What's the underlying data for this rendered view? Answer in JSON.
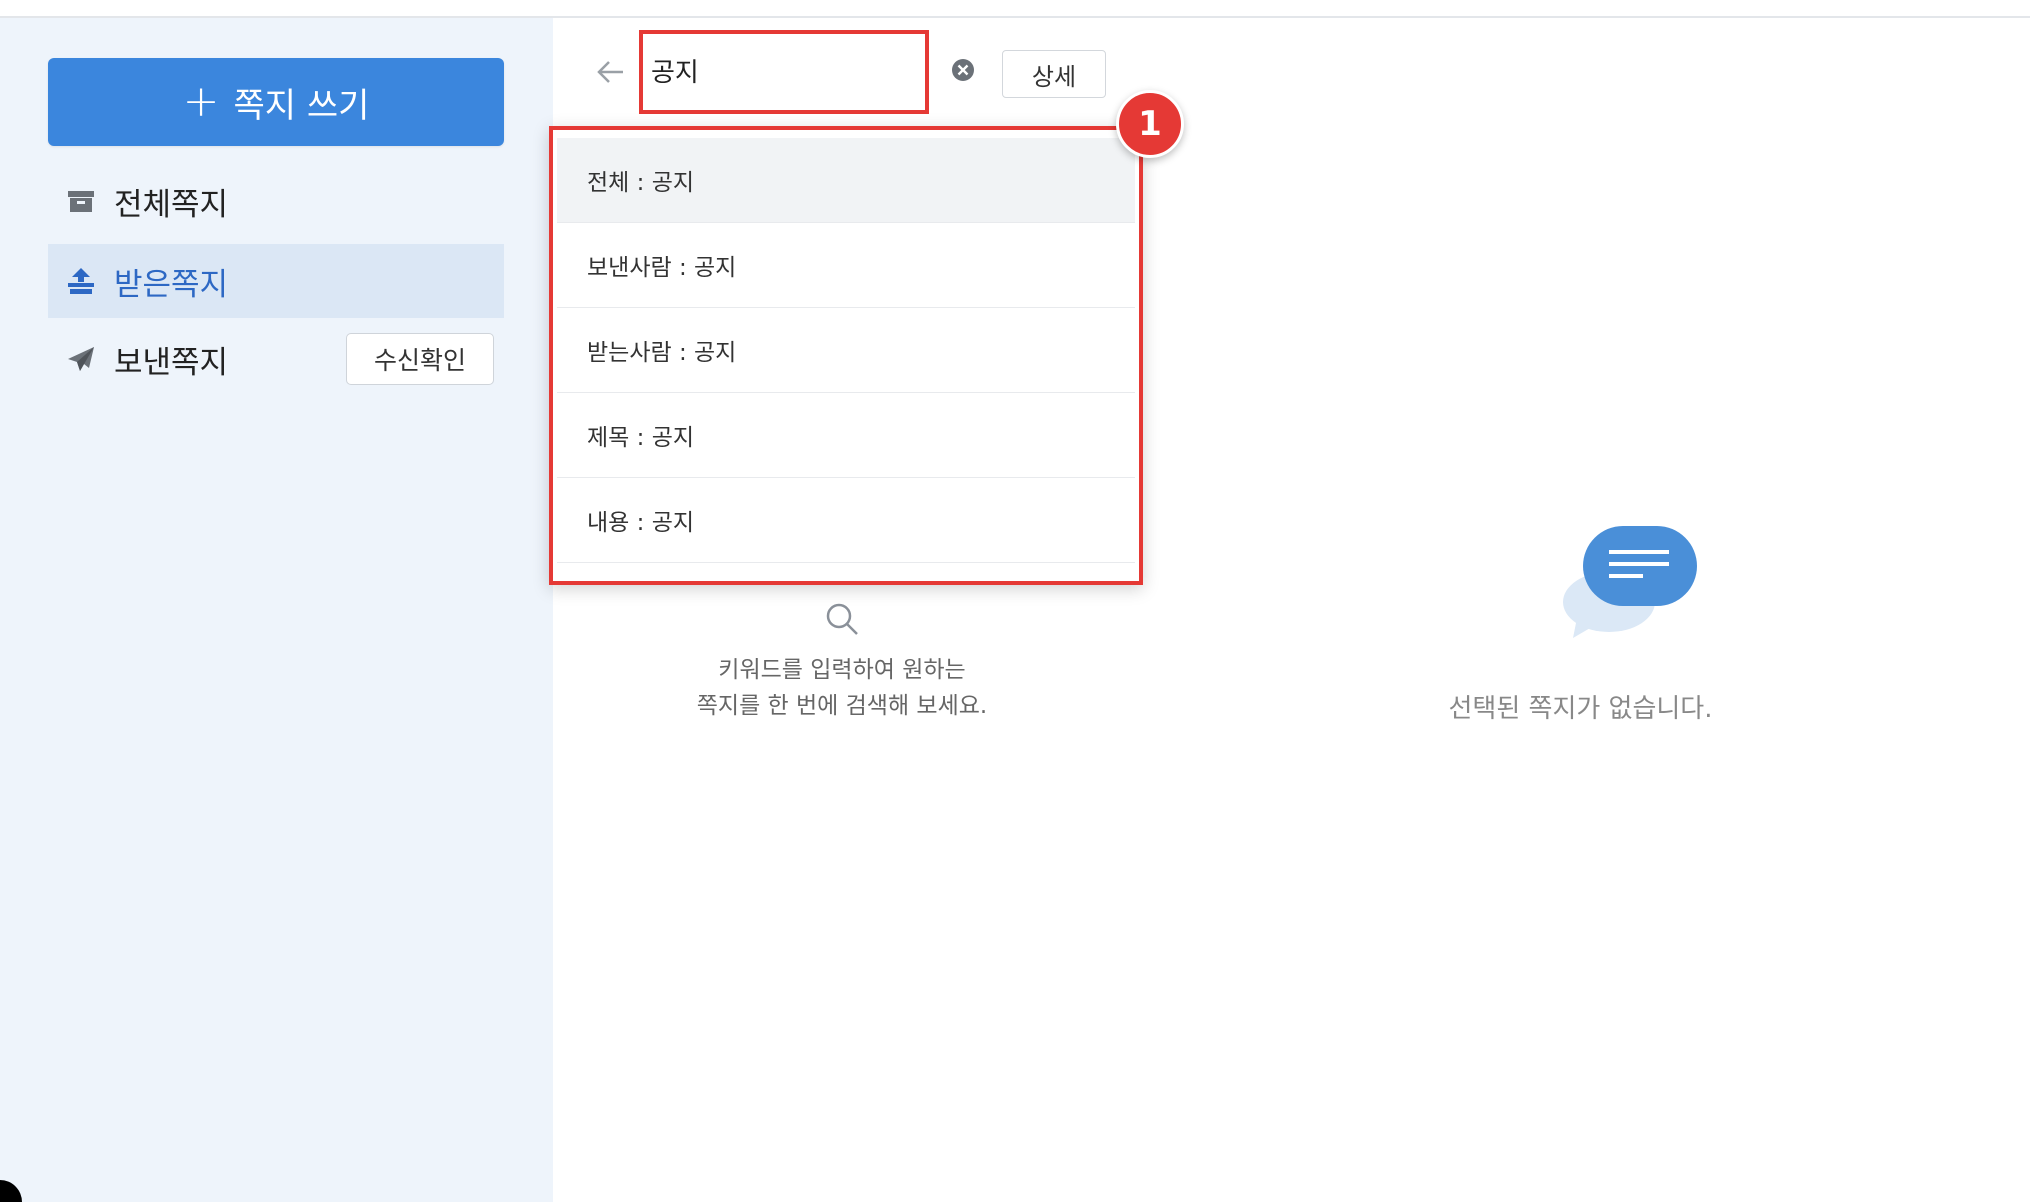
{
  "sidebar": {
    "compose_label": "쪽지 쓰기",
    "items": [
      {
        "label": "전체쪽지",
        "icon": "archive-icon"
      },
      {
        "label": "받은쪽지",
        "icon": "inbox-icon",
        "active": true
      },
      {
        "label": "보낸쪽지",
        "icon": "paper-plane-icon"
      }
    ],
    "receipt_button": "수신확인"
  },
  "search": {
    "value": "공지",
    "detail_button": "상세",
    "suggestions": [
      "전체 : 공지",
      "보낸사람 : 공지",
      "받는사람 : 공지",
      "제목 : 공지",
      "내용 : 공지"
    ],
    "badge": "1",
    "hint_line1": "키워드를 입력하여 원하는",
    "hint_line2": "쪽지를 한 번에 검색해 보세요."
  },
  "detail": {
    "empty_text": "선택된 쪽지가 없습니다."
  },
  "colors": {
    "accent": "#3b86dd",
    "highlight": "#e53935",
    "sidebar_bg": "#eef4fb",
    "active_bg": "#dbe7f5"
  }
}
